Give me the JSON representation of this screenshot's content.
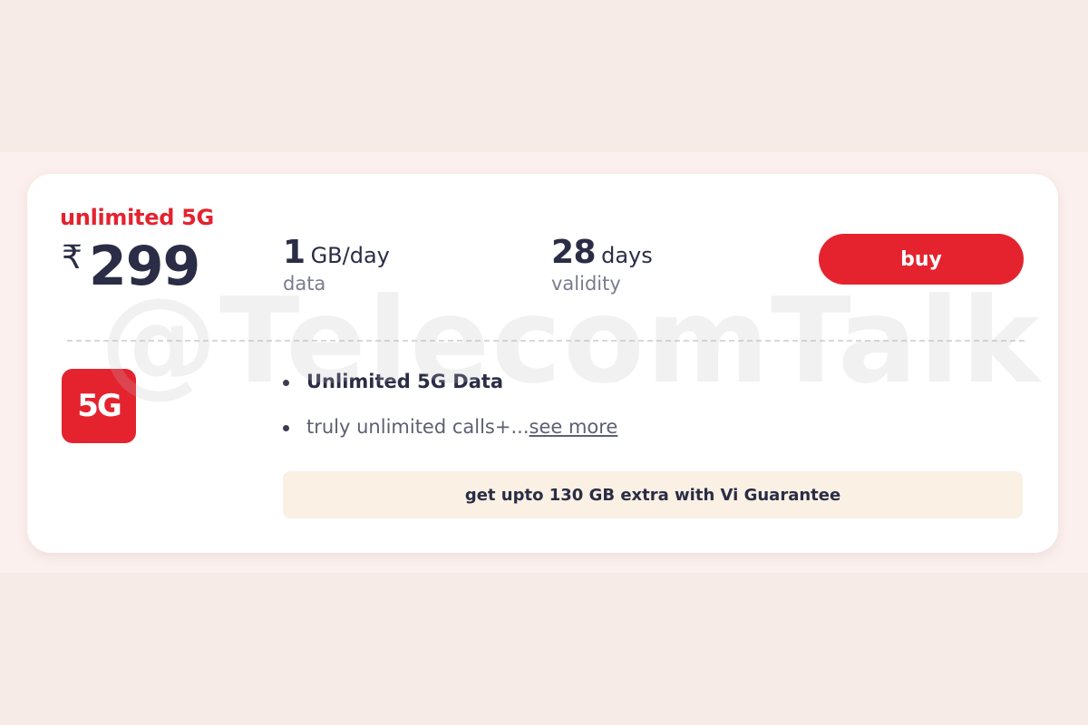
{
  "plan": {
    "tag": "unlimited 5G",
    "currency_symbol": "₹",
    "price": "299"
  },
  "stats": {
    "data": {
      "value": "1",
      "unit": "GB/day",
      "label": "data"
    },
    "validity": {
      "value": "28",
      "unit": "days",
      "label": "validity"
    }
  },
  "buy_label": "buy",
  "badge": {
    "text": "5G",
    "color": "#e4232f"
  },
  "benefits": {
    "item1": "Unlimited 5G Data",
    "item2": "truly unlimited calls+...",
    "see_more": "see more"
  },
  "guarantee": "get upto 130 GB extra with Vi Guarantee",
  "watermark": "@TelecomTalk",
  "colors": {
    "accent": "#e4232f",
    "text_primary": "#2a2d45",
    "text_muted": "#7a7c8e",
    "page_bg": "#f6ebe6",
    "guarantee_bg": "#faf0e4"
  }
}
